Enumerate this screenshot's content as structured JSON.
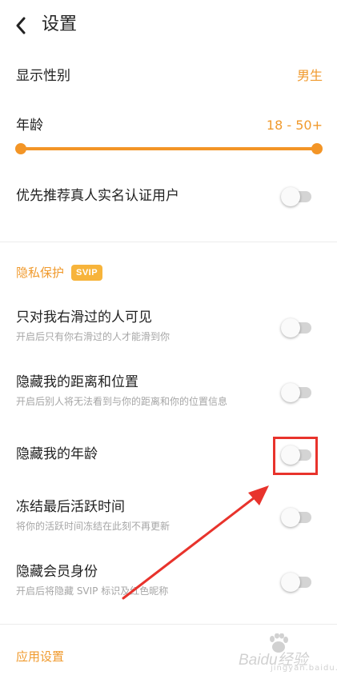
{
  "header": {
    "title": "设置"
  },
  "gender": {
    "label": "显示性别",
    "value": "男生"
  },
  "age": {
    "label": "年龄",
    "value": "18 - 50+",
    "range_low_fraction": 0.0,
    "range_high_fraction": 1.0
  },
  "verified_pref": {
    "label": "优先推荐真人实名认证用户",
    "enabled": false
  },
  "privacy": {
    "section_title": "隐私保护",
    "badge": "SVIP",
    "items": [
      {
        "title": "只对我右滑过的人可见",
        "subtitle": "开启后只有你右滑过的人才能滑到你",
        "enabled": false
      },
      {
        "title": "隐藏我的距离和位置",
        "subtitle": "开启后别人将无法看到与你的距离和你的位置信息",
        "enabled": false
      },
      {
        "title": "隐藏我的年龄",
        "subtitle": "",
        "enabled": false
      },
      {
        "title": "冻结最后活跃时间",
        "subtitle": "将你的活跃时间冻结在此刻不再更新",
        "enabled": false
      },
      {
        "title": "隐藏会员身份",
        "subtitle": "开启后将隐藏 SVIP 标识及红色昵称",
        "enabled": false
      }
    ]
  },
  "app_settings": {
    "section_title": "应用设置"
  },
  "colors": {
    "accent": "#f09a2d",
    "annotation": "#e8332c",
    "toggle_off_track": "#d4d4d4"
  },
  "watermark": {
    "text": "Baidu经验",
    "sub": "jingyan.baidu.com"
  }
}
